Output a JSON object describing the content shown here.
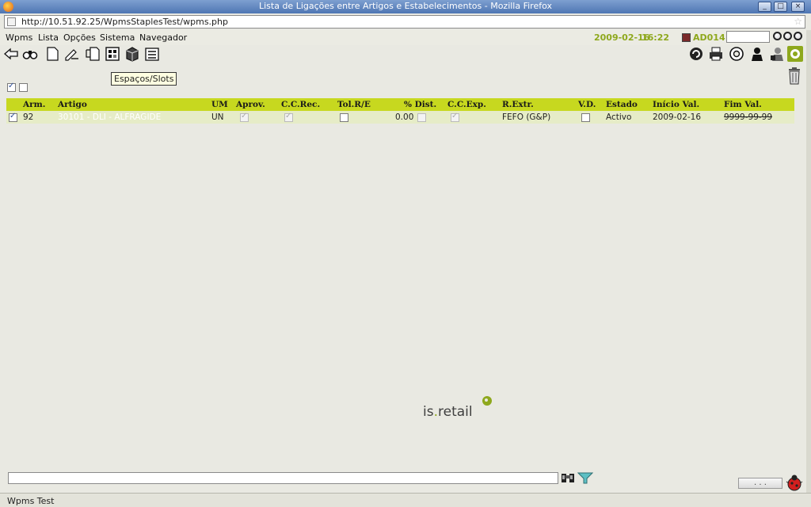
{
  "window": {
    "title": "Lista de Ligações entre Artigos e Estabelecimentos - Mozilla Firefox"
  },
  "browser": {
    "url": "http://10.51.92.25/WpmsStaplesTest/wpms.php"
  },
  "menu": {
    "items": [
      "Wpms",
      "Lista",
      "Opções",
      "Sistema",
      "Navegador"
    ],
    "date": "2009-02-16",
    "time": "16:22",
    "user": "AD014"
  },
  "toolbar": {
    "left_icons": [
      "back-arrow-icon",
      "binoculars-icon",
      "new-document-icon",
      "edit-pen-icon",
      "copy-document-icon",
      "grid-layout-icon",
      "box-icon",
      "list-icon"
    ],
    "right_icons": [
      "refresh-icon",
      "print-icon",
      "lifebuoy-icon",
      "user-icon",
      "user-settings-icon",
      "exit-icon"
    ]
  },
  "tooltip": "Espaços/Slots",
  "table": {
    "columns": [
      "Arm.",
      "Artigo",
      "UM",
      "Aprov.",
      "C.C.Rec.",
      "Tol.R/E",
      "% Dist.",
      "C.C.Exp.",
      "R.Extr.",
      "V.D.",
      "Estado",
      "Início Val.",
      "Fim Val."
    ],
    "rows": [
      {
        "selected": true,
        "arm": "92",
        "artigo": "30101 - DLI - ALFRAGIDE",
        "um": "UN",
        "aprov": true,
        "cc_rec": true,
        "tol_re": false,
        "dist": "0.00",
        "dist_flag": false,
        "cc_exp": true,
        "r_extr": "FEFO (G&P)",
        "vd": false,
        "estado": "Activo",
        "inicio_val": "2009-02-16",
        "fim_val": "9999-99-99"
      }
    ]
  },
  "logo": {
    "text_main": "is",
    "text_dot": ".",
    "text_rest": "retail"
  },
  "bottom": {
    "dots_label": ". . .",
    "status": "Wpms Test"
  }
}
